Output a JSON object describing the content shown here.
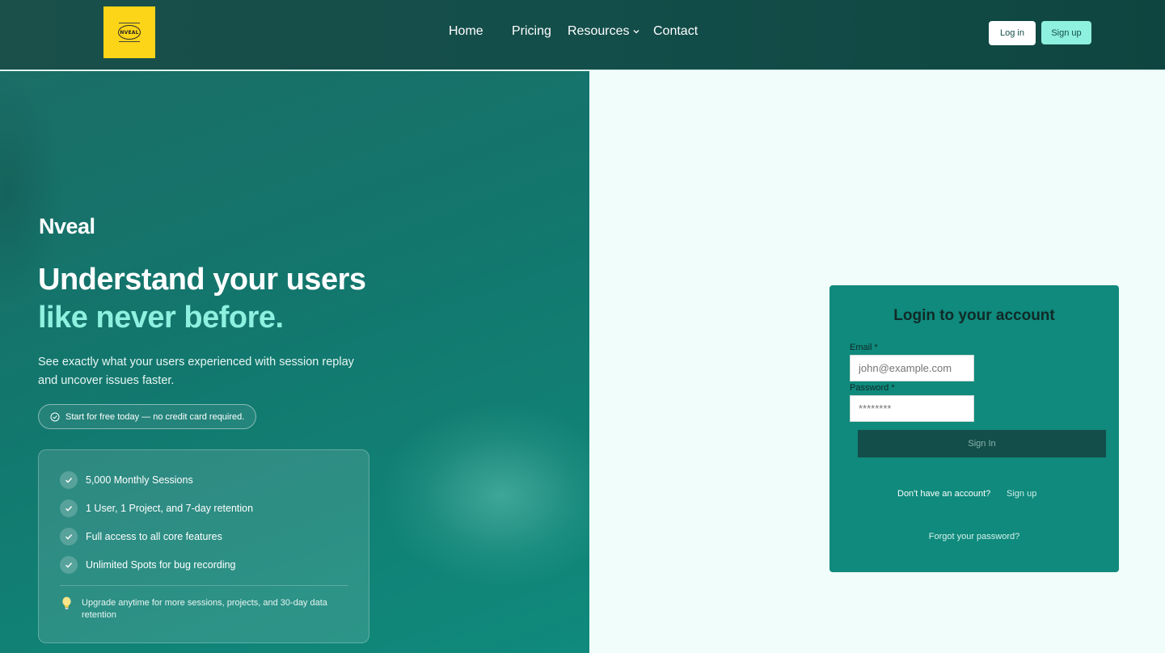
{
  "header": {
    "logo": {
      "small_text": "NVEAL"
    },
    "nav": [
      {
        "label": "Home"
      },
      {
        "label": "Pricing"
      },
      {
        "label": "Resources"
      },
      {
        "label": "Contact"
      }
    ],
    "login_label": "Log in",
    "signup_label": "Sign up"
  },
  "hero": {
    "brand": "Nveal",
    "headline_line1": "Understand your users",
    "headline_line2": "like never before.",
    "subtext": "See exactly what your users experienced with session replay and uncover issues faster.",
    "pill_text": "Start for free today — no credit card required.",
    "features": [
      "5,000 Monthly Sessions",
      "1 User, 1 Project, and 7-day retention",
      "Full access to all core features",
      "Unlimited Spots for bug recording"
    ],
    "tip": "Upgrade anytime for more sessions, projects, and 30-day data retention"
  },
  "login": {
    "title": "Login to your account",
    "email_label": "Email *",
    "email_placeholder": "john@example.com",
    "password_label": "Password *",
    "password_placeholder": "********",
    "signin_label": "Sign In",
    "no_account_text": "Don't have an account?",
    "signup_link": "Sign up",
    "forgot_text": "Forgot your password?"
  },
  "colors": {
    "header_bg": "#134e4a",
    "hero_bg": "#13766d",
    "accent_mint": "#8ef0df",
    "logo_yellow": "#fcd418",
    "card_bg": "#0f8a7c",
    "page_bg": "#f0fdfa"
  }
}
